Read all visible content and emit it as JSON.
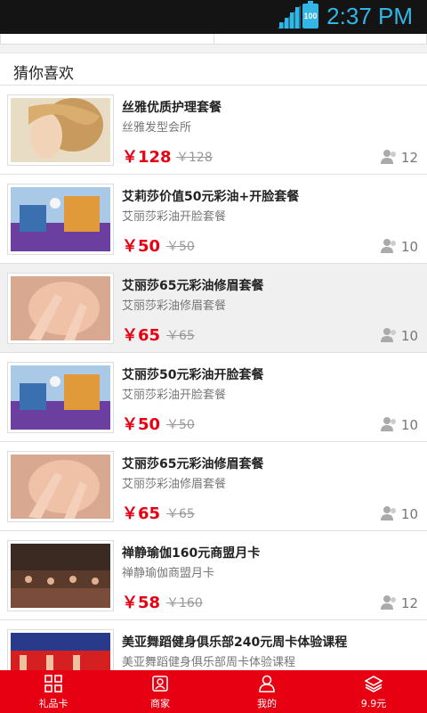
{
  "status_bar": {
    "time": "2:37 PM",
    "battery": "100",
    "accent": "#33b5e5"
  },
  "section": {
    "title": "猜你喜欢"
  },
  "items": [
    {
      "title": "丝雅优质护理套餐",
      "subtitle": "丝雅发型会所",
      "price": "￥128",
      "original_price": "￥128",
      "count": "12",
      "image": "hair-photo"
    },
    {
      "title": "艾莉莎价值50元彩油+开脸套餐",
      "subtitle": "艾丽莎彩油开脸套餐",
      "price": "￥50",
      "original_price": "￥50",
      "count": "10",
      "image": "salon-photo"
    },
    {
      "title": "艾丽莎65元彩油修眉套餐",
      "subtitle": "艾丽莎彩油修眉套餐",
      "price": "￥65",
      "original_price": "￥65",
      "count": "10",
      "image": "eyebrow-photo"
    },
    {
      "title": "艾丽莎50元彩油开脸套餐",
      "subtitle": "艾丽莎彩油开脸套餐",
      "price": "￥50",
      "original_price": "￥50",
      "count": "10",
      "image": "salon-photo"
    },
    {
      "title": "艾丽莎65元彩油修眉套餐",
      "subtitle": "艾丽莎彩油修眉套餐",
      "price": "￥65",
      "original_price": "￥65",
      "count": "10",
      "image": "eyebrow-photo"
    },
    {
      "title": "禅静瑜伽160元商盟月卡",
      "subtitle": "禅静瑜伽商盟月卡",
      "price": "￥58",
      "original_price": "￥160",
      "count": "12",
      "image": "yoga-photo"
    },
    {
      "title": "美亚舞蹈健身俱乐部240元周卡体验课程",
      "subtitle": "美亚舞蹈健身俱乐部周卡体验课程",
      "price": "",
      "original_price": "",
      "count": "",
      "image": "dance-photo"
    }
  ],
  "tabbar": {
    "color": "#e60012",
    "tabs": [
      {
        "label": "礼品卡",
        "icon": "grid-icon"
      },
      {
        "label": "商家",
        "icon": "merchant-icon"
      },
      {
        "label": "我的",
        "icon": "user-icon"
      },
      {
        "label": "9.9元",
        "icon": "layers-icon"
      }
    ]
  }
}
